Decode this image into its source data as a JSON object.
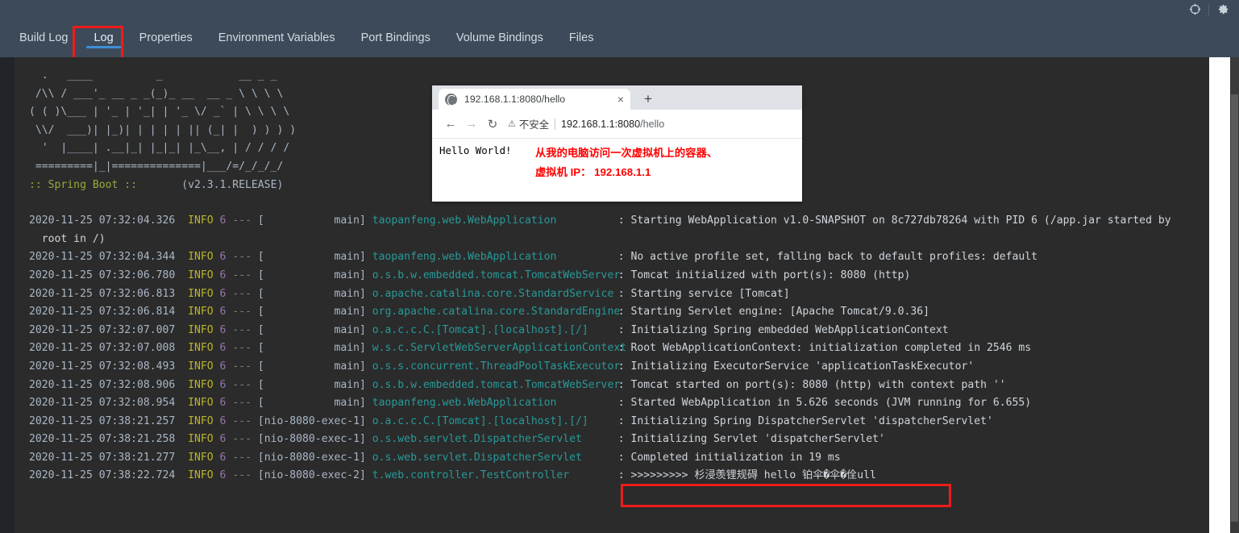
{
  "titlebar": {
    "icons": [
      {
        "name": "target-icon",
        "glyph": "⊕"
      },
      {
        "name": "gear-icon",
        "glyph": "⚙"
      }
    ]
  },
  "tabs": [
    {
      "label": "Build Log",
      "active": false
    },
    {
      "label": "Log",
      "active": true
    },
    {
      "label": "Properties",
      "active": false
    },
    {
      "label": "Environment Variables",
      "active": false
    },
    {
      "label": "Port Bindings",
      "active": false
    },
    {
      "label": "Volume Bindings",
      "active": false
    },
    {
      "label": "Files",
      "active": false
    }
  ],
  "console": {
    "banner": {
      "art": "  .   ____          _            __ _ _\n /\\\\ / ___'_ __ _ _(_)_ __  __ _ \\ \\ \\ \\\n( ( )\\___ | '_ | '_| | '_ \\/ _` | \\ \\ \\ \\\n \\\\/  ___)| |_)| | | | | || (_| |  ) ) ) )\n  '  |____| .__|_| |_|_| |_\\__, | / / / /\n =========|_|==============|___/=/_/_/_/",
      "name": ":: Spring Boot ::",
      "version": "(v2.3.1.RELEASE)"
    },
    "lines": [
      {
        "ts": "2020-11-25 07:32:04.326",
        "level": "INFO",
        "pid": "6",
        "dash": "---",
        "thread": "[           main]",
        "logger": "taopanfeng.web.WebApplication",
        "msg": ": Starting WebApplication v1.0-SNAPSHOT on 8c727db78264 with PID 6 (/app.jar started by",
        "cont": "  root in /)"
      },
      {
        "ts": "2020-11-25 07:32:04.344",
        "level": "INFO",
        "pid": "6",
        "dash": "---",
        "thread": "[           main]",
        "logger": "taopanfeng.web.WebApplication",
        "msg": ": No active profile set, falling back to default profiles: default"
      },
      {
        "ts": "2020-11-25 07:32:06.780",
        "level": "INFO",
        "pid": "6",
        "dash": "---",
        "thread": "[           main]",
        "logger": "o.s.b.w.embedded.tomcat.TomcatWebServer",
        "msg": ": Tomcat initialized with port(s): 8080 (http)"
      },
      {
        "ts": "2020-11-25 07:32:06.813",
        "level": "INFO",
        "pid": "6",
        "dash": "---",
        "thread": "[           main]",
        "logger": "o.apache.catalina.core.StandardService",
        "msg": ": Starting service [Tomcat]"
      },
      {
        "ts": "2020-11-25 07:32:06.814",
        "level": "INFO",
        "pid": "6",
        "dash": "---",
        "thread": "[           main]",
        "logger": "org.apache.catalina.core.StandardEngine",
        "msg": ": Starting Servlet engine: [Apache Tomcat/9.0.36]"
      },
      {
        "ts": "2020-11-25 07:32:07.007",
        "level": "INFO",
        "pid": "6",
        "dash": "---",
        "thread": "[           main]",
        "logger": "o.a.c.c.C.[Tomcat].[localhost].[/]",
        "msg": ": Initializing Spring embedded WebApplicationContext"
      },
      {
        "ts": "2020-11-25 07:32:07.008",
        "level": "INFO",
        "pid": "6",
        "dash": "---",
        "thread": "[           main]",
        "logger": "w.s.c.ServletWebServerApplicationContext",
        "msg": ": Root WebApplicationContext: initialization completed in 2546 ms"
      },
      {
        "ts": "2020-11-25 07:32:08.493",
        "level": "INFO",
        "pid": "6",
        "dash": "---",
        "thread": "[           main]",
        "logger": "o.s.s.concurrent.ThreadPoolTaskExecutor",
        "msg": ": Initializing ExecutorService 'applicationTaskExecutor'"
      },
      {
        "ts": "2020-11-25 07:32:08.906",
        "level": "INFO",
        "pid": "6",
        "dash": "---",
        "thread": "[           main]",
        "logger": "o.s.b.w.embedded.tomcat.TomcatWebServer",
        "msg": ": Tomcat started on port(s): 8080 (http) with context path ''"
      },
      {
        "ts": "2020-11-25 07:32:08.954",
        "level": "INFO",
        "pid": "6",
        "dash": "---",
        "thread": "[           main]",
        "logger": "taopanfeng.web.WebApplication",
        "msg": ": Started WebApplication in 5.626 seconds (JVM running for 6.655)"
      },
      {
        "ts": "2020-11-25 07:38:21.257",
        "level": "INFO",
        "pid": "6",
        "dash": "---",
        "thread": "[nio-8080-exec-1]",
        "logger": "o.a.c.c.C.[Tomcat].[localhost].[/]",
        "msg": ": Initializing Spring DispatcherServlet 'dispatcherServlet'"
      },
      {
        "ts": "2020-11-25 07:38:21.258",
        "level": "INFO",
        "pid": "6",
        "dash": "---",
        "thread": "[nio-8080-exec-1]",
        "logger": "o.s.web.servlet.DispatcherServlet",
        "msg": ": Initializing Servlet 'dispatcherServlet'"
      },
      {
        "ts": "2020-11-25 07:38:21.277",
        "level": "INFO",
        "pid": "6",
        "dash": "---",
        "thread": "[nio-8080-exec-1]",
        "logger": "o.s.web.servlet.DispatcherServlet",
        "msg": ": Completed initialization in 19 ms"
      },
      {
        "ts": "2020-11-25 07:38:22.724",
        "level": "INFO",
        "pid": "6",
        "dash": "---",
        "thread": "[nio-8080-exec-2]",
        "logger": "t.web.controller.TestController",
        "msg": ": >>>>>>>>> 杉浸羡锂规碍 hello 铂伞�伞�佺ull"
      }
    ]
  },
  "browser": {
    "tab": {
      "title": "192.168.1.1:8080/hello",
      "close_glyph": "×",
      "favicon_name": "globe-favicon"
    },
    "newtab_glyph": "+",
    "nav": {
      "back_glyph": "←",
      "forward_glyph": "→",
      "reload_glyph": "↻"
    },
    "omnibox": {
      "warning_glyph": "⚠",
      "security_label": "不安全",
      "url_host": "192.168.1.1:8080",
      "url_path": "/hello"
    },
    "page": {
      "body_text": "Hello World!",
      "note_line1": "从我的电脑访问一次虚拟机上的容器、",
      "note_line2": "虚拟机 IP： 192.168.1.1"
    }
  },
  "colors": {
    "accent_blue": "#3d8fd6",
    "annotation_red": "#ee1c1c",
    "console_bg": "#2b2b2b",
    "chrome_bg": "#3c4a59",
    "level_info": "#bbb529",
    "pid": "#9876aa",
    "logger": "#299999"
  }
}
